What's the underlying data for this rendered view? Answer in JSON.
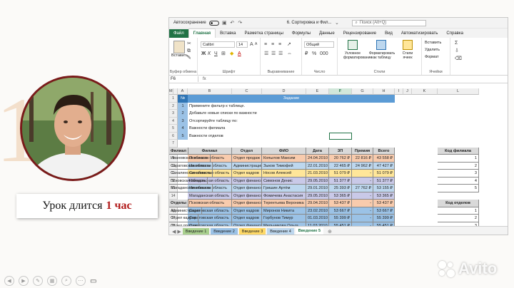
{
  "slide": {
    "caption": {
      "prefix": "Урок длится",
      "highlight": "1 час"
    },
    "deco_digit": "1",
    "watermark": "Avito"
  },
  "excel": {
    "autosave_label": "Автосохранение",
    "doc_title": "6. Сортировка и Фил...",
    "search_placeholder": "Поиск (Alt+Q)",
    "ribbon_tabs": [
      "Файл",
      "Главная",
      "Вставка",
      "Разметка страницы",
      "Формулы",
      "Данные",
      "Рецензирование",
      "Вид",
      "Автоматизировать",
      "Справка"
    ],
    "groups": {
      "clipboard": "Буфер обмена",
      "font": "Шрифт",
      "alignment": "Выравнивание",
      "number": "Число",
      "styles": "Стили",
      "cells": "Ячейки",
      "paste_label": "Вставить",
      "font_name": "Calibri",
      "font_size": "14",
      "number_format": "Общий",
      "cond_format": "Условное форматирование",
      "format_table": "Форматировать как таблицу",
      "cell_styles": "Стили ячеек",
      "insert": "Вставить",
      "delete": "Удалить",
      "format": "Формат"
    },
    "name_box": "F6",
    "fx": "fx",
    "columns": [
      "A",
      "B",
      "C",
      "D",
      "E",
      "F",
      "G",
      "H",
      "I",
      "J",
      "K",
      "L",
      "M"
    ],
    "row_numbers": [
      "1",
      "2",
      "3",
      "4",
      "5",
      "6",
      "7",
      "8",
      "9",
      "10",
      "11",
      "12",
      "13",
      "14",
      "15",
      "16",
      "17",
      "18",
      "19",
      "20",
      "21"
    ],
    "task_header": {
      "num": "№",
      "title": "Задание"
    },
    "tasks": [
      {
        "num": "1",
        "text": "Примените фильтр к таблице."
      },
      {
        "num": "2",
        "text": "Добавьте новые списки по важности"
      },
      {
        "num": "3",
        "text": "Отсортируйте таблицу по:"
      },
      {
        "num": "4",
        "text": "Важности филиала"
      },
      {
        "num": "5",
        "text": "Важности отделов"
      }
    ],
    "table_headers": [
      "Филиал",
      "Отдел",
      "ФИО",
      "Дата",
      "ЗП",
      "Премия",
      "Всего"
    ],
    "rows": [
      [
        "Псковская область",
        "Отдел продаж",
        "Копылов Максим",
        "24.04.2010",
        "20 762 ₽",
        "22 816 ₽",
        "43 558 ₽"
      ],
      [
        "Ивановская область",
        "Администрация",
        "Зыков Тимофей",
        "22.01.2010",
        "22 465 ₽",
        "24 962 ₽",
        "47 427 ₽"
      ],
      [
        "Сахалинская область",
        "Отдел кадров",
        "Носов Алексей",
        "21.03.2010",
        "51 079 ₽",
        "-",
        "51 079 ₽"
      ],
      [
        "Магаданская область",
        "Отдел финансов",
        "Симонов Денис",
        "29.05.2010",
        "51 377 ₽",
        "-",
        "51 377 ₽"
      ],
      [
        "Ивановская область",
        "Отдел финансов",
        "Гришин Артём",
        "29.01.2010",
        "25 393 ₽",
        "27 762 ₽",
        "53 155 ₽"
      ],
      [
        "Магаданская область",
        "Отдел финансов",
        "Фомичева Анастасия",
        "29.05.2010",
        "53 365 ₽",
        "-",
        "53 365 ₽"
      ],
      [
        "Псковская область",
        "Отдел финансов",
        "Терентьева Вероника",
        "29.04.2010",
        "53 437 ₽",
        "-",
        "53 437 ₽"
      ],
      [
        "Саратовская область",
        "Отдел кадров",
        "Миронов Никита",
        "23.02.2010",
        "53 667 ₽",
        "-",
        "53 667 ₽"
      ],
      [
        "Саратовская область",
        "Отдел кадров",
        "Горбунов Тимур",
        "01.03.2010",
        "55 399 ₽",
        "-",
        "55 399 ₽"
      ],
      [
        "Саратовская область",
        "Отдел финансов",
        "Мельникова Ольга",
        "11.03.2010",
        "55 451 ₽",
        "-",
        "55 451 ₽"
      ],
      [
        "Псковская область",
        "Отдел кадров",
        "Петухова Ариана",
        "23.03.2010",
        "55 859 ₽",
        "-",
        "55 859 ₽"
      ],
      [
        "Псковская область",
        "Отдел продаж",
        "Харитонов Мирон",
        "27.02.2010",
        "28 192 ₽",
        "30 945 ₽",
        "59 137 ₽"
      ],
      [
        "Псковская область",
        "Отдел продаж",
        "Рыбаков Алексей",
        "21.03.2010",
        "29 514 ₽",
        "...",
        "62 ..."
      ]
    ],
    "branch_header": [
      "Код филиала",
      "Филиал"
    ],
    "branches": [
      [
        "1",
        "Ивановская область"
      ],
      [
        "2",
        "Саратовская область"
      ],
      [
        "3",
        "Сахалинская область"
      ],
      [
        "4",
        "Псковская область"
      ],
      [
        "5",
        "Магаданская область"
      ]
    ],
    "dept_header": [
      "Код отделов",
      "Отделы"
    ],
    "depts": [
      [
        "1",
        "Администрация"
      ],
      [
        "2",
        "Отдел кадров"
      ],
      [
        "3",
        "Отдел продаж"
      ],
      [
        "4",
        "Отдел финансов"
      ]
    ],
    "sheet_tabs": [
      "Введение 1",
      "Введение 2",
      "Введение 3",
      "Введение 4",
      "Введение 5"
    ],
    "branch_colors": {
      "Псковская область": "#f8cbad",
      "Ивановская область": "#bdd7ee",
      "Сахалинская область": "#ffe699",
      "Магаданская область": "#c9c9e8",
      "Саратовская область": "#9bc2e6"
    },
    "tab_colors": [
      "#a9d08e",
      "#9bc2e6",
      "#ffd966",
      "#bdd7ee",
      "#ffffff"
    ],
    "accent": "#217346"
  }
}
